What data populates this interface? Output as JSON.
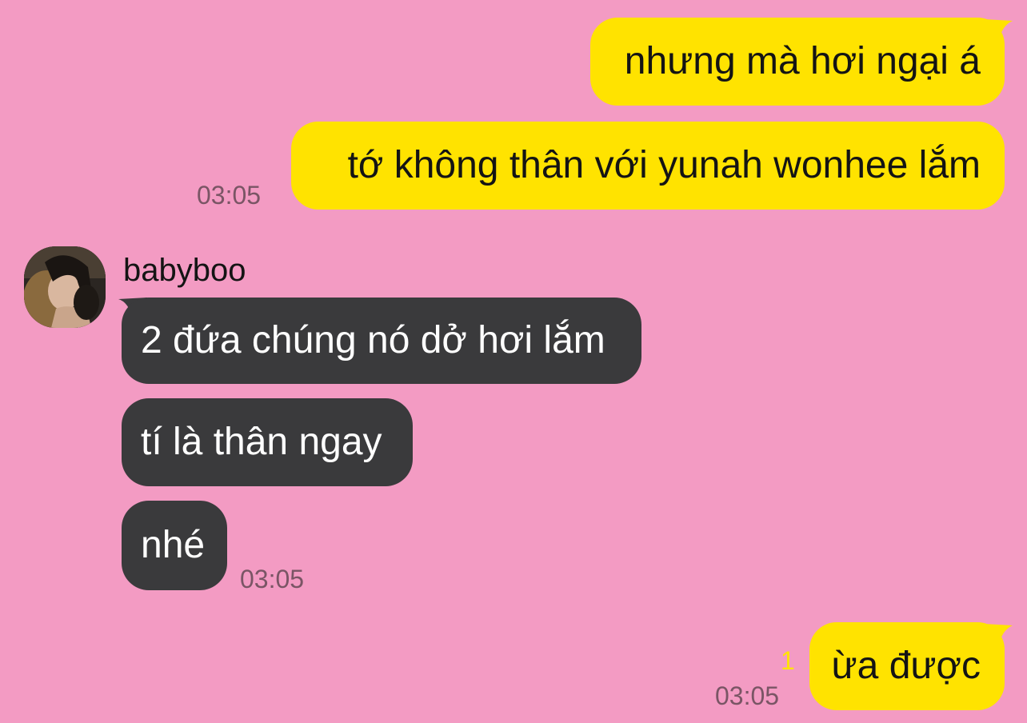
{
  "chat": {
    "messages_out_1": {
      "line1": "nhưng mà hơi ngại á",
      "line2": "tớ không thân với yunah wonhee lắm",
      "time": "03:05"
    },
    "contact": {
      "name": "babyboo"
    },
    "messages_in": {
      "line1": "2 đứa chúng nó dở hơi lắm",
      "line2": "tí là thân ngay",
      "line3": "nhé",
      "time": "03:05"
    },
    "messages_out_2": {
      "line1": "ừa được",
      "unread_count": "1",
      "time": "03:05"
    }
  },
  "colors": {
    "background": "#f39bc3",
    "outgoing_bubble": "#ffe300",
    "incoming_bubble": "#3a3a3c",
    "timestamp": "#7a5565",
    "unread_indicator": "#ffe300"
  },
  "icons": {
    "avatar": "profile-photo"
  }
}
